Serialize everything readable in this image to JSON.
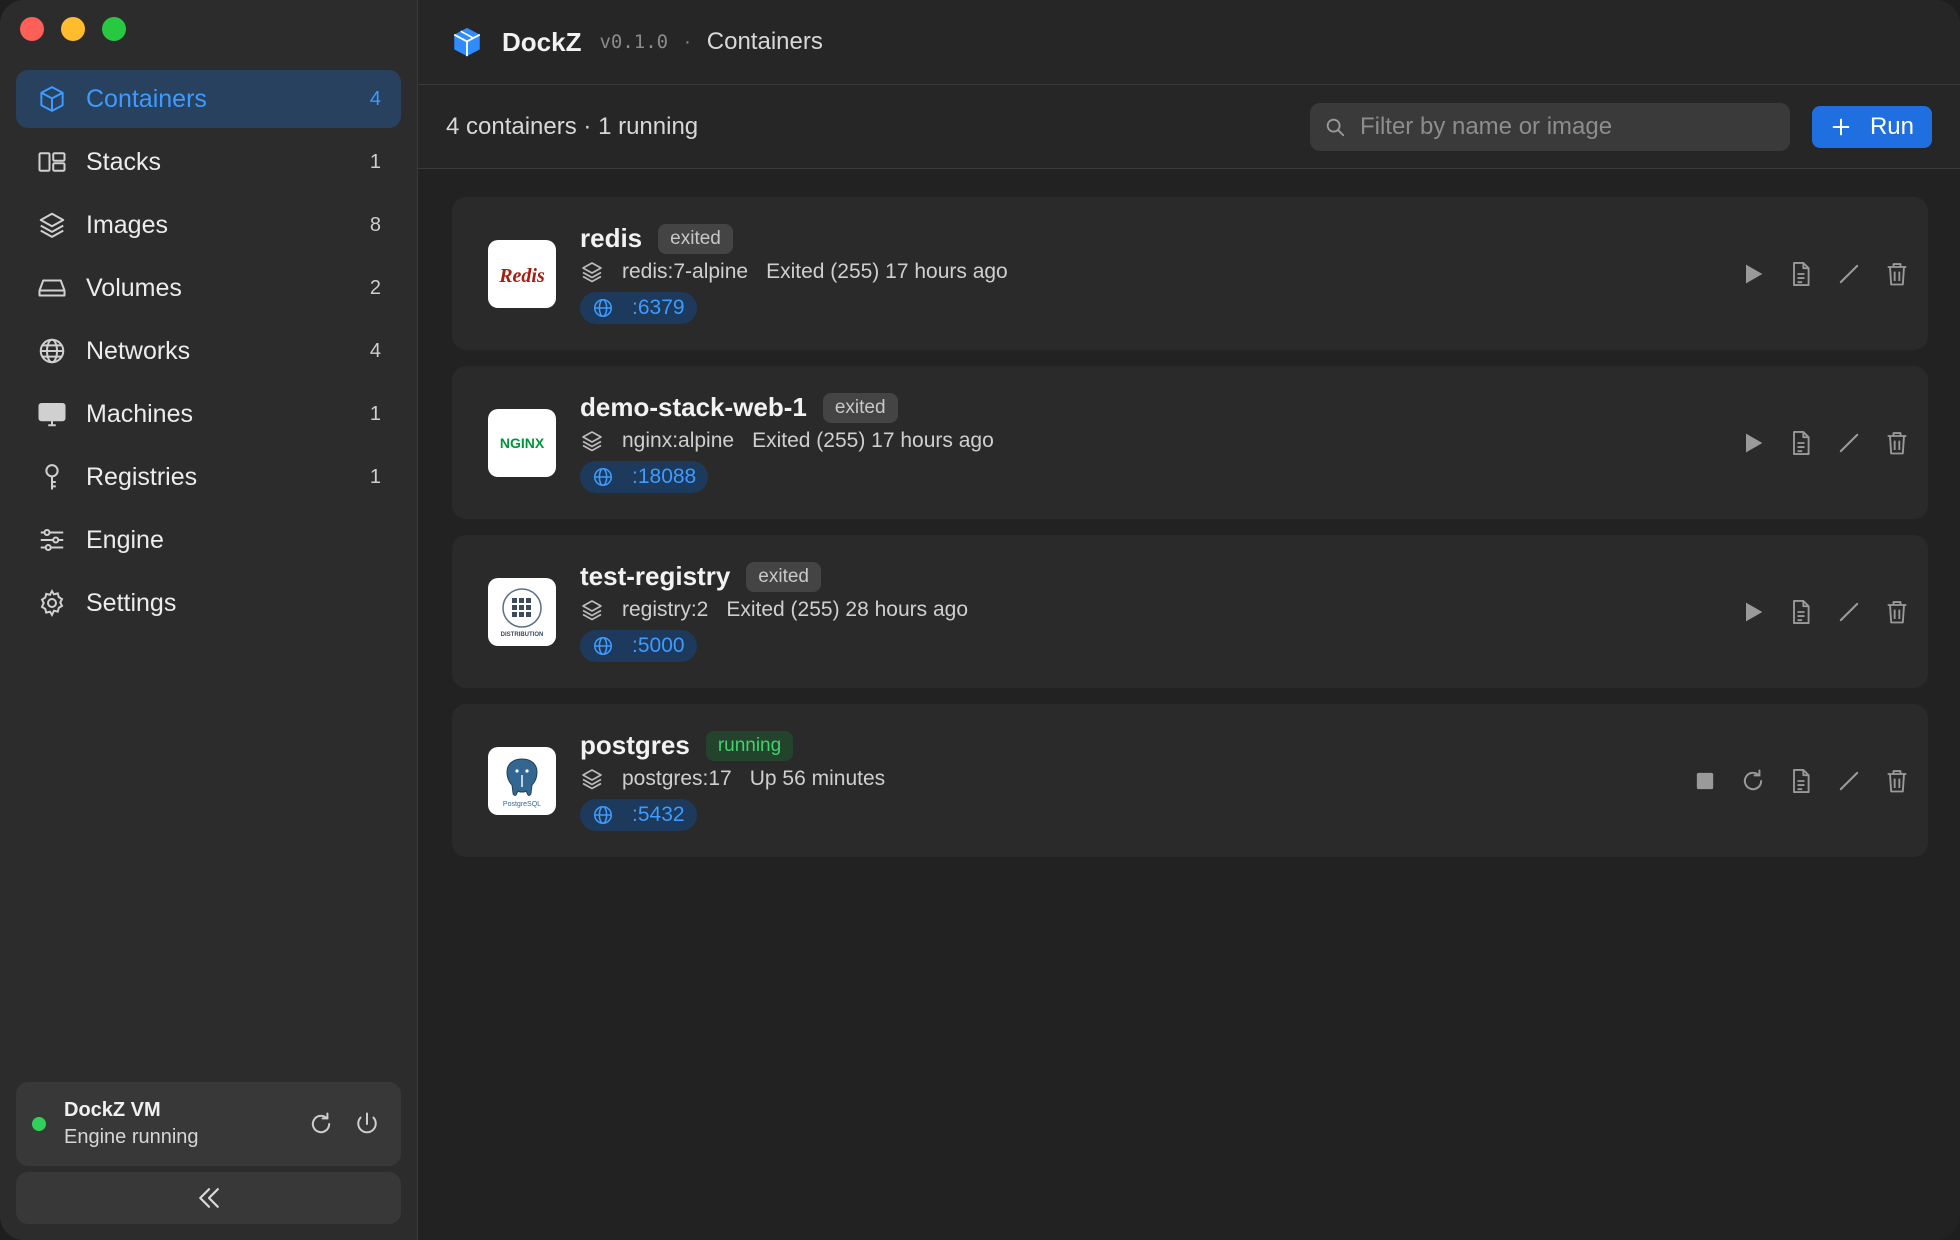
{
  "app": {
    "name": "DockZ",
    "version": "v0.1.0",
    "separator": "·",
    "page_title": "Containers"
  },
  "sidebar": {
    "items": [
      {
        "label": "Containers",
        "count": "4",
        "icon": "cube-icon",
        "active": true
      },
      {
        "label": "Stacks",
        "count": "1",
        "icon": "stacks-icon"
      },
      {
        "label": "Images",
        "count": "8",
        "icon": "layers-icon"
      },
      {
        "label": "Volumes",
        "count": "2",
        "icon": "drive-icon"
      },
      {
        "label": "Networks",
        "count": "4",
        "icon": "globe-icon"
      },
      {
        "label": "Machines",
        "count": "1",
        "icon": "monitor-icon"
      },
      {
        "label": "Registries",
        "count": "1",
        "icon": "key-icon"
      },
      {
        "label": "Engine",
        "count": "",
        "icon": "sliders-icon"
      },
      {
        "label": "Settings",
        "count": "",
        "icon": "gear-icon"
      }
    ],
    "vm": {
      "name": "DockZ VM",
      "status": "Engine running",
      "status_color": "#30d158"
    },
    "collapse_icon": "chevrons-left-icon"
  },
  "toolbar": {
    "summary": "4 containers · 1 running",
    "search_placeholder": "Filter by name or image",
    "run_label": "Run"
  },
  "containers": [
    {
      "name": "redis",
      "state": "exited",
      "image": "redis:7-alpine",
      "status": "Exited (255) 17 hours ago",
      "port": ":6379",
      "logo": "redis-logo"
    },
    {
      "name": "demo-stack-web-1",
      "state": "exited",
      "image": "nginx:alpine",
      "status": "Exited (255) 17 hours ago",
      "port": ":18088",
      "logo": "nginx-logo"
    },
    {
      "name": "test-registry",
      "state": "exited",
      "image": "registry:2",
      "status": "Exited (255) 28 hours ago",
      "port": ":5000",
      "logo": "distribution-logo"
    },
    {
      "name": "postgres",
      "state": "running",
      "image": "postgres:17",
      "status": "Up 56 minutes",
      "port": ":5432",
      "logo": "postgresql-logo"
    }
  ],
  "logo_text": {
    "redis": "Redis",
    "nginx": "NGINX",
    "distribution": "DISTRIBUTION",
    "postgres": "PostgreSQL"
  },
  "colors": {
    "accent": "#3d9bff",
    "run_button": "#1f6fe0",
    "running": "#3ed46b",
    "active_nav_bg": "#27415f"
  }
}
